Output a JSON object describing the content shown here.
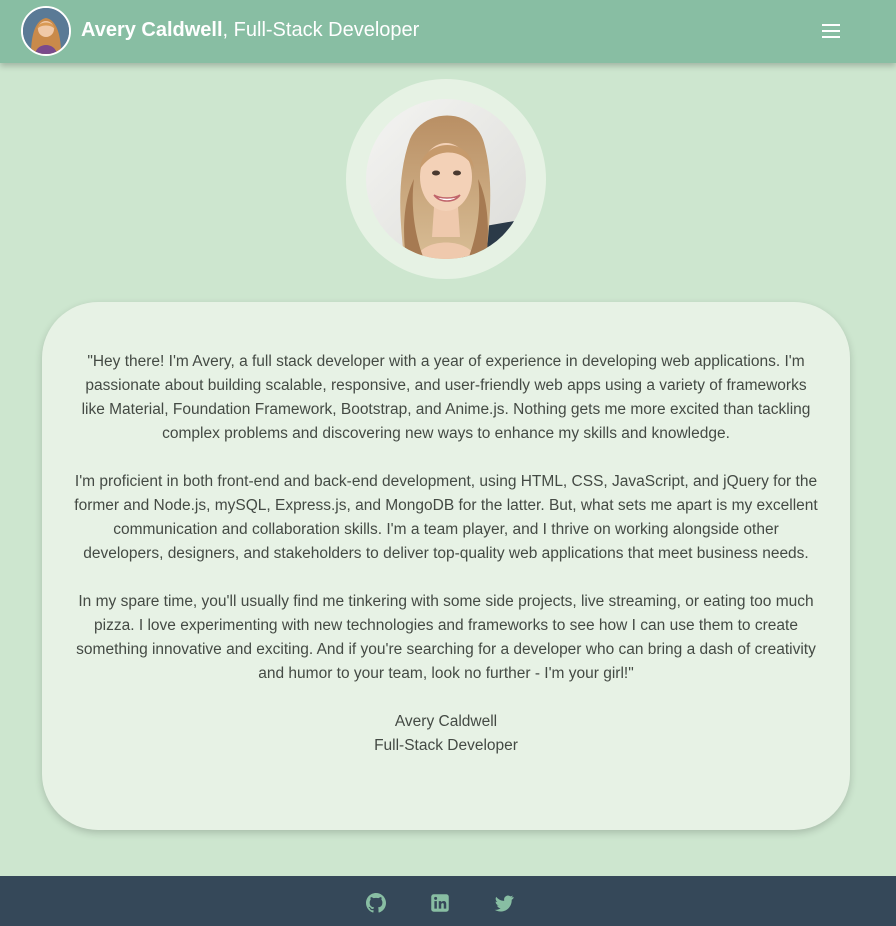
{
  "header": {
    "name": "Avery Caldwell",
    "role": ", Full-Stack Developer",
    "menu_icon": "hamburger-menu-icon"
  },
  "profile": {
    "photo": "portrait-photo"
  },
  "bio": {
    "paragraphs": [
      "\"Hey there! I'm Avery, a full stack developer with a year of experience in developing web applications. I'm passionate about building scalable, responsive, and user-friendly web apps using a variety of frameworks like Material, Foundation Framework, Bootstrap, and Anime.js. Nothing gets me more excited than tackling complex problems and discovering new ways to enhance my skills and knowledge.",
      "I'm proficient in both front-end and back-end development, using HTML, CSS, JavaScript, and jQuery for the former and Node.js, mySQL, Express.js, and MongoDB for the latter. But, what sets me apart is my excellent communication and collaboration skills. I'm a team player, and I thrive on working alongside other developers, designers, and stakeholders to deliver top-quality web applications that meet business needs.",
      "In my spare time, you'll usually find me tinkering with some side projects, live streaming, or eating too much pizza. I love experimenting with new technologies and frameworks to see how I can use them to create something innovative and exciting. And if you're searching for a developer who can bring a dash of creativity and humor to your team, look no further - I'm your girl!\""
    ],
    "signature_name": "Avery Caldwell",
    "signature_title": "Full-Stack Developer"
  },
  "footer": {
    "icons": [
      "github-icon",
      "linkedin-icon",
      "twitter-icon"
    ]
  },
  "colors": {
    "background": "#cde6cf",
    "navbar": "#88bea3",
    "card": "#e7f2e5",
    "footer": "#354859",
    "footer_icon": "#88bea3"
  }
}
